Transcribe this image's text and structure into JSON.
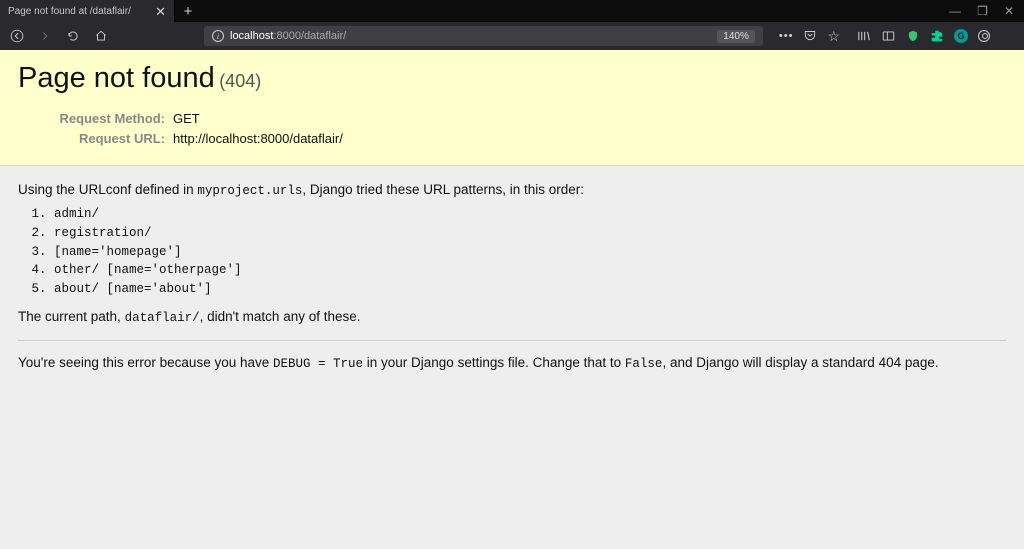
{
  "window": {
    "minimize": "—",
    "maximize": "❐",
    "close": "✕"
  },
  "tab": {
    "title": "Page not found at /dataflair/",
    "close": "✕",
    "new": "+"
  },
  "url": {
    "host": "localhost",
    "rest": ":8000/dataflair/",
    "zoom": "140%"
  },
  "addr_actions": {
    "dots": "•••",
    "pocket": "⌄",
    "star": "☆"
  },
  "right": {
    "library": "⫿⫿⫿\\",
    "sidebar": "▭",
    "puzzle": "⚙"
  },
  "error": {
    "heading": "Page not found",
    "status": "(404)",
    "method_label": "Request Method:",
    "method_value": "GET",
    "url_label": "Request URL:",
    "url_value": "http://localhost:8000/dataflair/",
    "intro_a": "Using the URLconf defined in ",
    "intro_mod": "myproject.urls",
    "intro_b": ", Django tried these URL patterns, in this order:",
    "patterns": [
      "admin/",
      "registration/",
      "[name='homepage']",
      "other/ [name='otherpage']",
      "about/ [name='about']"
    ],
    "nomatch_a": "The current path, ",
    "nomatch_path": "dataflair/",
    "nomatch_b": ", didn't match any of these.",
    "explain_a": "You're seeing this error because you have ",
    "explain_debug": "DEBUG = True",
    "explain_b": " in your Django settings file. Change that to ",
    "explain_false": "False",
    "explain_c": ", and Django will display a standard 404 page."
  }
}
